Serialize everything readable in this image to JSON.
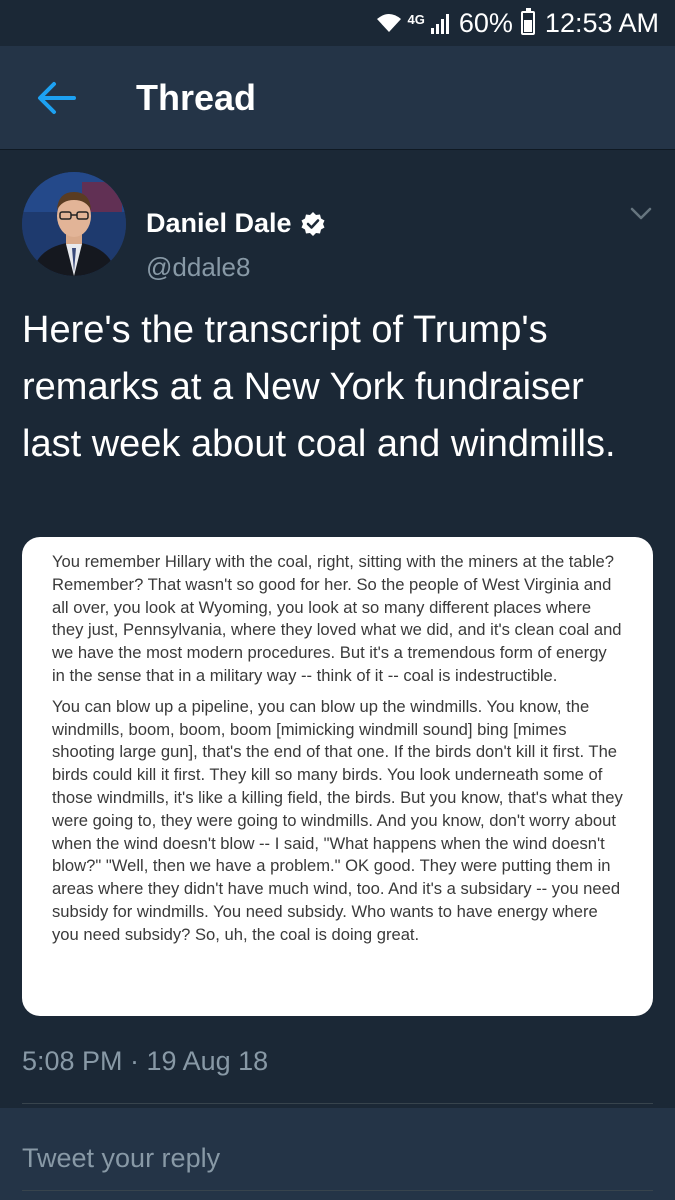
{
  "status_bar": {
    "network": "4G",
    "battery": "60%",
    "time": "12:53 AM"
  },
  "header": {
    "title": "Thread"
  },
  "tweet": {
    "author_name": "Daniel Dale",
    "author_handle": "@ddale8",
    "text": "Here's the transcript of Trump's remarks at a New York fundraiser last week about coal and windmills.",
    "image_paragraphs": [
      "You remember Hillary with the coal, right, sitting with the miners at the table? Remember? That wasn't so good for her. So the people of West Virginia and all over, you look at Wyoming, you look at so many different places where they just, Pennsylvania, where they loved what we did, and it's clean coal and we have the most modern procedures. But it's a tremendous form of energy in the sense that in a military way -- think of it -- coal is indestructible.",
      "You can blow up a pipeline, you can blow up the windmills. You know, the windmills, boom, boom, boom [mimicking windmill sound] bing [mimes shooting large gun], that's the end of that one. If the birds don't kill it first. The birds could kill it first. They kill so many birds. You look underneath some of those windmills, it's like a killing field, the birds. But you know, that's what they were going to, they were going to windmills. And you know, don't worry about when the wind doesn't blow -- I said, \"What happens when the wind doesn't blow?\" \"Well, then we have a problem.\" OK good. They were putting them in areas where they didn't have much wind, too. And it's a subsidary -- you need subsidy for windmills. You need subsidy. Who wants to have energy where you need subsidy? So, uh, the coal is doing great."
    ],
    "timestamp": "5:08 PM · 19 Aug 18"
  },
  "reply": {
    "placeholder": "Tweet your reply"
  },
  "colors": {
    "background": "#1b2836",
    "header": "#243447",
    "accent": "#1da1f2",
    "secondary_text": "#8899a6"
  }
}
